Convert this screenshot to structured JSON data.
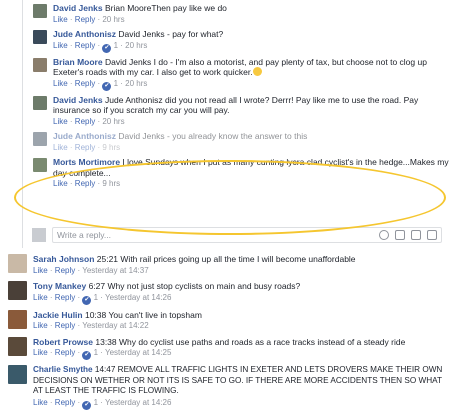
{
  "replies": [
    {
      "name": "David Jenks",
      "mention": "Brian Moore",
      "text": "Then pay like we do",
      "actions": [
        "Like",
        "Reply"
      ],
      "reactions": null,
      "time": "20 hrs",
      "avatar_color": "#6d7b6a",
      "faded": false
    },
    {
      "name": "Jude Anthonisz",
      "mention": "David Jenks",
      "text": " - pay for what?",
      "actions": [
        "Like",
        "Reply"
      ],
      "reactions": "1",
      "time": "20 hrs",
      "avatar_color": "#3a4a5a",
      "faded": false
    },
    {
      "name": "Brian Moore",
      "mention": "David Jenks",
      "text": " I do - I'm also a motorist, and pay plenty of tax, but choose not to clog up Exeter's roads with my car. I also get to work quicker.",
      "actions": [
        "Like",
        "Reply"
      ],
      "reactions": "1",
      "time": "20 hrs",
      "avatar_color": "#8a7d6b",
      "faded": false
    },
    {
      "name": "David Jenks",
      "mention": "Jude Anthonisz",
      "text": " did you not read all I wrote? Derrr! Pay like me to use the road. Pay insurance so if you scratch my car you will pay.",
      "actions": [
        "Like",
        "Reply"
      ],
      "reactions": null,
      "time": "20 hrs",
      "avatar_color": "#6d7b6a",
      "faded": false
    },
    {
      "name": "Jude Anthonisz",
      "mention": "David Jenks",
      "text": " - you already know the answer to this",
      "actions": [
        "Like",
        "Reply"
      ],
      "reactions": null,
      "time": "9 hrs",
      "avatar_color": "#3a4a5a",
      "faded": true
    },
    {
      "name": "Morts Mortimore",
      "mention": "",
      "text": "I love Sundays when I put as many cunting lycra clad cyclist's in the hedge...Makes my day complete...",
      "actions": [
        "Like",
        "Reply"
      ],
      "reactions": null,
      "time": "9 hrs",
      "avatar_color": "#7a8a70",
      "faded": false
    }
  ],
  "write_reply": {
    "placeholder": "Write a reply...",
    "icons": [
      "emoji-icon",
      "camera-icon",
      "gif-icon",
      "sticker-icon"
    ]
  },
  "comments": [
    {
      "name": "Sarah Johnson",
      "code": "25:21",
      "text": "With rail prices going up all the time I will become unaffordable",
      "actions": [
        "Like",
        "Reply"
      ],
      "reactions": null,
      "time": "Yesterday at 14:37",
      "avatar_color": "#c9b9a6"
    },
    {
      "name": "Tony Mankey",
      "code": "6:27",
      "text": "Why not just stop cyclists on main and busy roads?",
      "actions": [
        "Like",
        "Reply"
      ],
      "reactions": "1",
      "time": "Yesterday at 14:26",
      "avatar_color": "#4a4038"
    },
    {
      "name": "Jackie Hulin",
      "code": "10:38",
      "text": "You can't live in topsham",
      "actions": [
        "Like",
        "Reply"
      ],
      "reactions": null,
      "time": "Yesterday at 14:22",
      "avatar_color": "#8a5a3a"
    },
    {
      "name": "Robert Prowse",
      "code": "13:38",
      "text": "Why do cyclist use paths and roads as a race tracks instead of a steady ride",
      "actions": [
        "Like",
        "Reply"
      ],
      "reactions": "1",
      "time": "Yesterday at 14:25",
      "avatar_color": "#5a4a3a"
    },
    {
      "name": "Charlie Smythe",
      "code": "14:47",
      "text": "REMOVE ALL TRAFFIC LIGHTS IN EXETER AND LETS DROVERS MAKE THEIR OWN DECISIONS ON WETHER OR NOT ITS IS SAFE TO GO. IF THERE ARE MORE ACCIDENTS THEN SO WHAT AT LEAST THE TRAFFIC IS FLOWING.",
      "actions": [
        "Like",
        "Reply"
      ],
      "reactions": "1",
      "time": "Yesterday at 14:26",
      "avatar_color": "#3a5a6a"
    }
  ],
  "colors": {
    "link": "#365899",
    "highlight": "#f5c62f",
    "reaction": "#4267b2"
  }
}
